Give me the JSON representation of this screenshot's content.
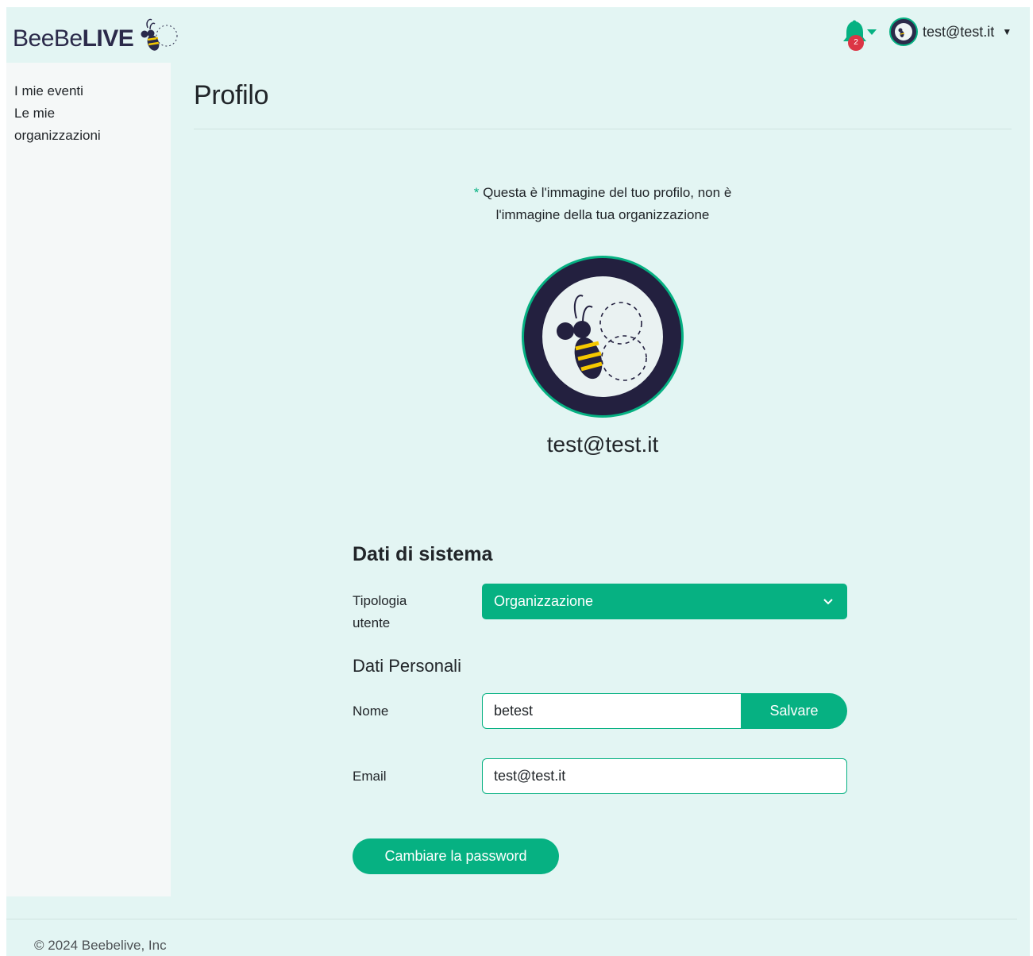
{
  "brand": {
    "light": "BeeBe",
    "bold": "LIVE"
  },
  "header": {
    "notifications_count": "2",
    "user_email": "test@test.it",
    "accent_color": "#06b182",
    "badge_color": "#dc3545"
  },
  "sidebar": {
    "items": [
      {
        "label": "I mie eventi"
      },
      {
        "label": "Le mie organizzazioni"
      }
    ]
  },
  "main": {
    "title": "Profilo",
    "note_prefix": "*",
    "note_text": "Questa è l'immagine del tuo profilo, non è l'immagine della tua organizzazione",
    "profile_email": "test@test.it",
    "system_section": {
      "title": "Dati di sistema",
      "user_type_label": "Tipologia utente",
      "user_type_value": "Organizzazione"
    },
    "personal_section": {
      "title": "Dati Personali",
      "name_label": "Nome",
      "name_value": "betest",
      "save_label": "Salvare",
      "email_label": "Email",
      "email_value": "test@test.it"
    },
    "change_password_label": "Cambiare la password"
  },
  "footer": {
    "copyright": "© 2024 Beebelive, Inc"
  }
}
